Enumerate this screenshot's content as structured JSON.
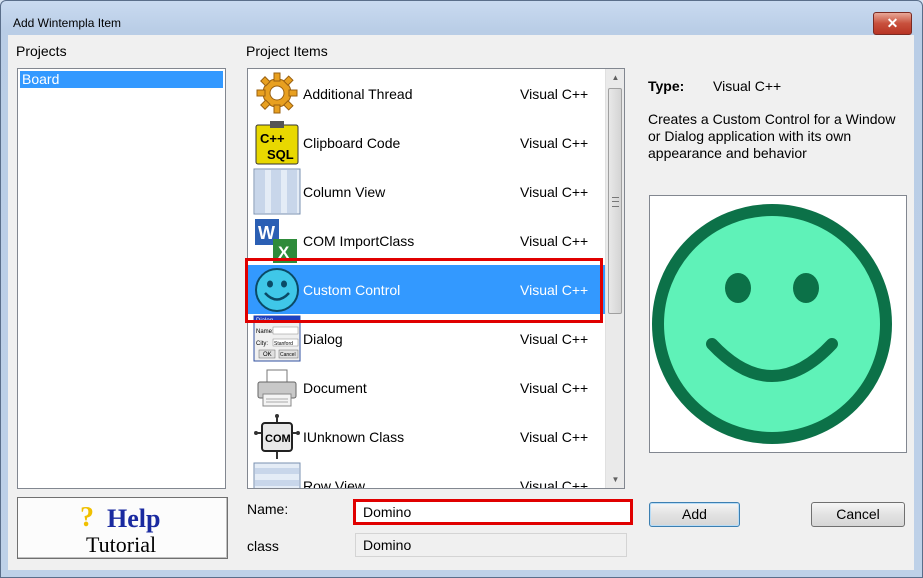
{
  "window": {
    "title": "Add Wintempla Item",
    "close_glyph": "✕"
  },
  "projects": {
    "label": "Projects",
    "items": [
      "Board"
    ]
  },
  "project_items": {
    "label": "Project Items",
    "rows": [
      {
        "name": "Additional Thread",
        "type": "Visual C++",
        "icon": "gear-icon"
      },
      {
        "name": "Clipboard Code",
        "type": "Visual C++",
        "icon": "cpp-sql-icon"
      },
      {
        "name": "Column View",
        "type": "Visual C++",
        "icon": "column-view-icon"
      },
      {
        "name": "COM ImportClass",
        "type": "Visual C++",
        "icon": "word-excel-icon"
      },
      {
        "name": "Custom Control",
        "type": "Visual C++",
        "icon": "smiley-icon",
        "selected": true
      },
      {
        "name": "Dialog",
        "type": "Visual C++",
        "icon": "dialog-icon"
      },
      {
        "name": "Document",
        "type": "Visual C++",
        "icon": "printer-icon"
      },
      {
        "name": "IUnknown Class",
        "type": "Visual C++",
        "icon": "com-chip-icon"
      },
      {
        "name": "Row View",
        "type": "Visual C++",
        "icon": "row-view-icon"
      }
    ]
  },
  "info": {
    "type_label": "Type:",
    "type_value": "Visual C++",
    "description": "Creates a Custom Control for a Window or Dialog application with its own appearance and behavior",
    "preview_icon": "smiley-icon"
  },
  "help": {
    "q": "?",
    "word": "Help",
    "tutorial": "Tutorial"
  },
  "form": {
    "name_label": "Name:",
    "name_value": "Domino",
    "class_label": "class",
    "class_value": "Domino"
  },
  "buttons": {
    "add": "Add",
    "cancel": "Cancel"
  },
  "dialog_icon_text": {
    "title": "Dialog",
    "name": "Name:",
    "city": "City:",
    "city_value": "Stanford",
    "ok": "OK",
    "cancel": "Cancel"
  },
  "com_icon_text": "COM",
  "cpp_sql_icon_text": {
    "top": "C++",
    "bottom": "SQL"
  },
  "word_icon_text": "W",
  "excel_icon_text": "X",
  "colors": {
    "selection": "#3399ff",
    "highlight": "#e00000",
    "smiley_face": "#5ff2b8",
    "smiley_outline": "#0c7148"
  }
}
